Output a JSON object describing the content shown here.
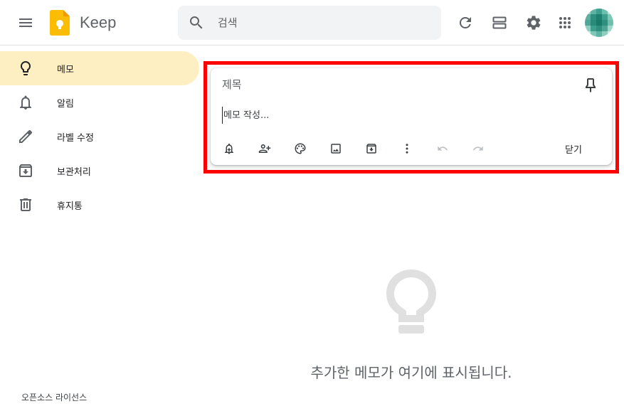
{
  "header": {
    "app_title": "Keep",
    "search_placeholder": "검색"
  },
  "sidebar": {
    "items": [
      {
        "label": "메모",
        "icon": "lightbulb-icon",
        "active": true
      },
      {
        "label": "알림",
        "icon": "bell-icon",
        "active": false
      },
      {
        "label": "라벨 수정",
        "icon": "pencil-icon",
        "active": false
      },
      {
        "label": "보관처리",
        "icon": "archive-icon",
        "active": false
      },
      {
        "label": "휴지통",
        "icon": "trash-icon",
        "active": false
      }
    ],
    "license_link": "오픈소스 라이선스"
  },
  "note_editor": {
    "title_placeholder": "제목",
    "body_placeholder": "메모 작성...",
    "close_label": "닫기",
    "tools": [
      "remind-me-icon",
      "collaborator-icon",
      "palette-icon",
      "image-icon",
      "archive-icon",
      "more-vert-icon",
      "undo-icon",
      "redo-icon"
    ]
  },
  "empty_state": {
    "message": "추가한 메모가 여기에 표시됩니다."
  },
  "colors": {
    "active_bg": "#feefc3",
    "highlight": "#ff0000",
    "search_bg": "#f1f3f4",
    "logo": "#fbbc04"
  }
}
